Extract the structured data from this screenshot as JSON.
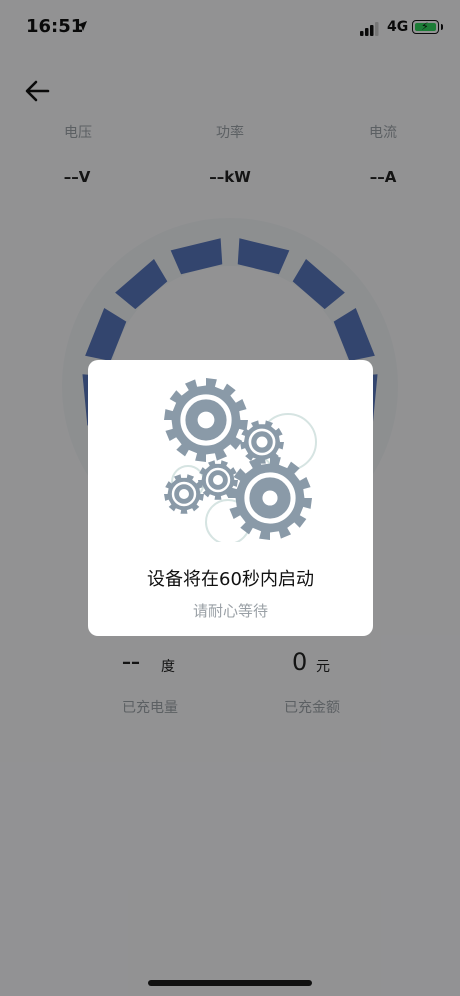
{
  "status_bar": {
    "time": "16:51",
    "network": "4G"
  },
  "metrics": [
    {
      "label": "电压",
      "value": "––V"
    },
    {
      "label": "功率",
      "value": "––kW"
    },
    {
      "label": "电流",
      "value": "––A"
    }
  ],
  "stats": {
    "energy_value": "––",
    "energy_unit": "度",
    "energy_label": "已充电量",
    "amount_value": "0",
    "amount_unit": "元",
    "amount_label": "已充金额"
  },
  "dialog": {
    "title": "设备将在60秒内启动",
    "subtitle": "请耐心等待"
  },
  "colors": {
    "gauge_segment": "#5573b8",
    "gauge_track": "#f0f1f3",
    "gear": "#8a9aa8",
    "overlay": "rgba(0,0,0,0.40)"
  }
}
